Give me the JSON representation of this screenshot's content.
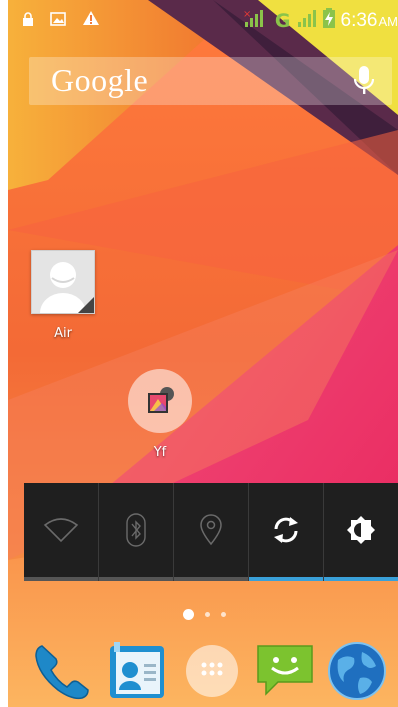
{
  "status_bar": {
    "time": "6:36",
    "ampm": "AM",
    "network": "G",
    "icons": [
      "lock-icon",
      "image-notification-icon",
      "warning-icon",
      "signal-icon",
      "battery-charging-icon"
    ]
  },
  "search": {
    "logo_text": "Google",
    "voice_icon": "mic-icon"
  },
  "apps": [
    {
      "label": "Air",
      "icon": "contact-placeholder-icon"
    },
    {
      "label": "Yf",
      "icon": "gallery-folder-icon"
    }
  ],
  "power_widget": {
    "toggles": [
      {
        "name": "wifi",
        "icon": "wifi-icon",
        "on": false
      },
      {
        "name": "bluetooth",
        "icon": "bluetooth-icon",
        "on": false
      },
      {
        "name": "location",
        "icon": "location-icon",
        "on": false
      },
      {
        "name": "sync",
        "icon": "sync-icon",
        "on": true
      },
      {
        "name": "brightness",
        "icon": "brightness-icon",
        "on": true
      }
    ]
  },
  "page_indicator": {
    "current": 1,
    "total": 3
  },
  "dock": [
    {
      "name": "phone",
      "icon": "phone-icon"
    },
    {
      "name": "contacts",
      "icon": "contacts-icon"
    },
    {
      "name": "app-drawer",
      "icon": "app-drawer-icon"
    },
    {
      "name": "messaging",
      "icon": "messaging-icon"
    },
    {
      "name": "browser",
      "icon": "globe-icon"
    }
  ],
  "colors": {
    "accent_indicator": "#3aa0d8",
    "signal": "#8bc34a",
    "widget_bg": "#1f1f1f"
  }
}
